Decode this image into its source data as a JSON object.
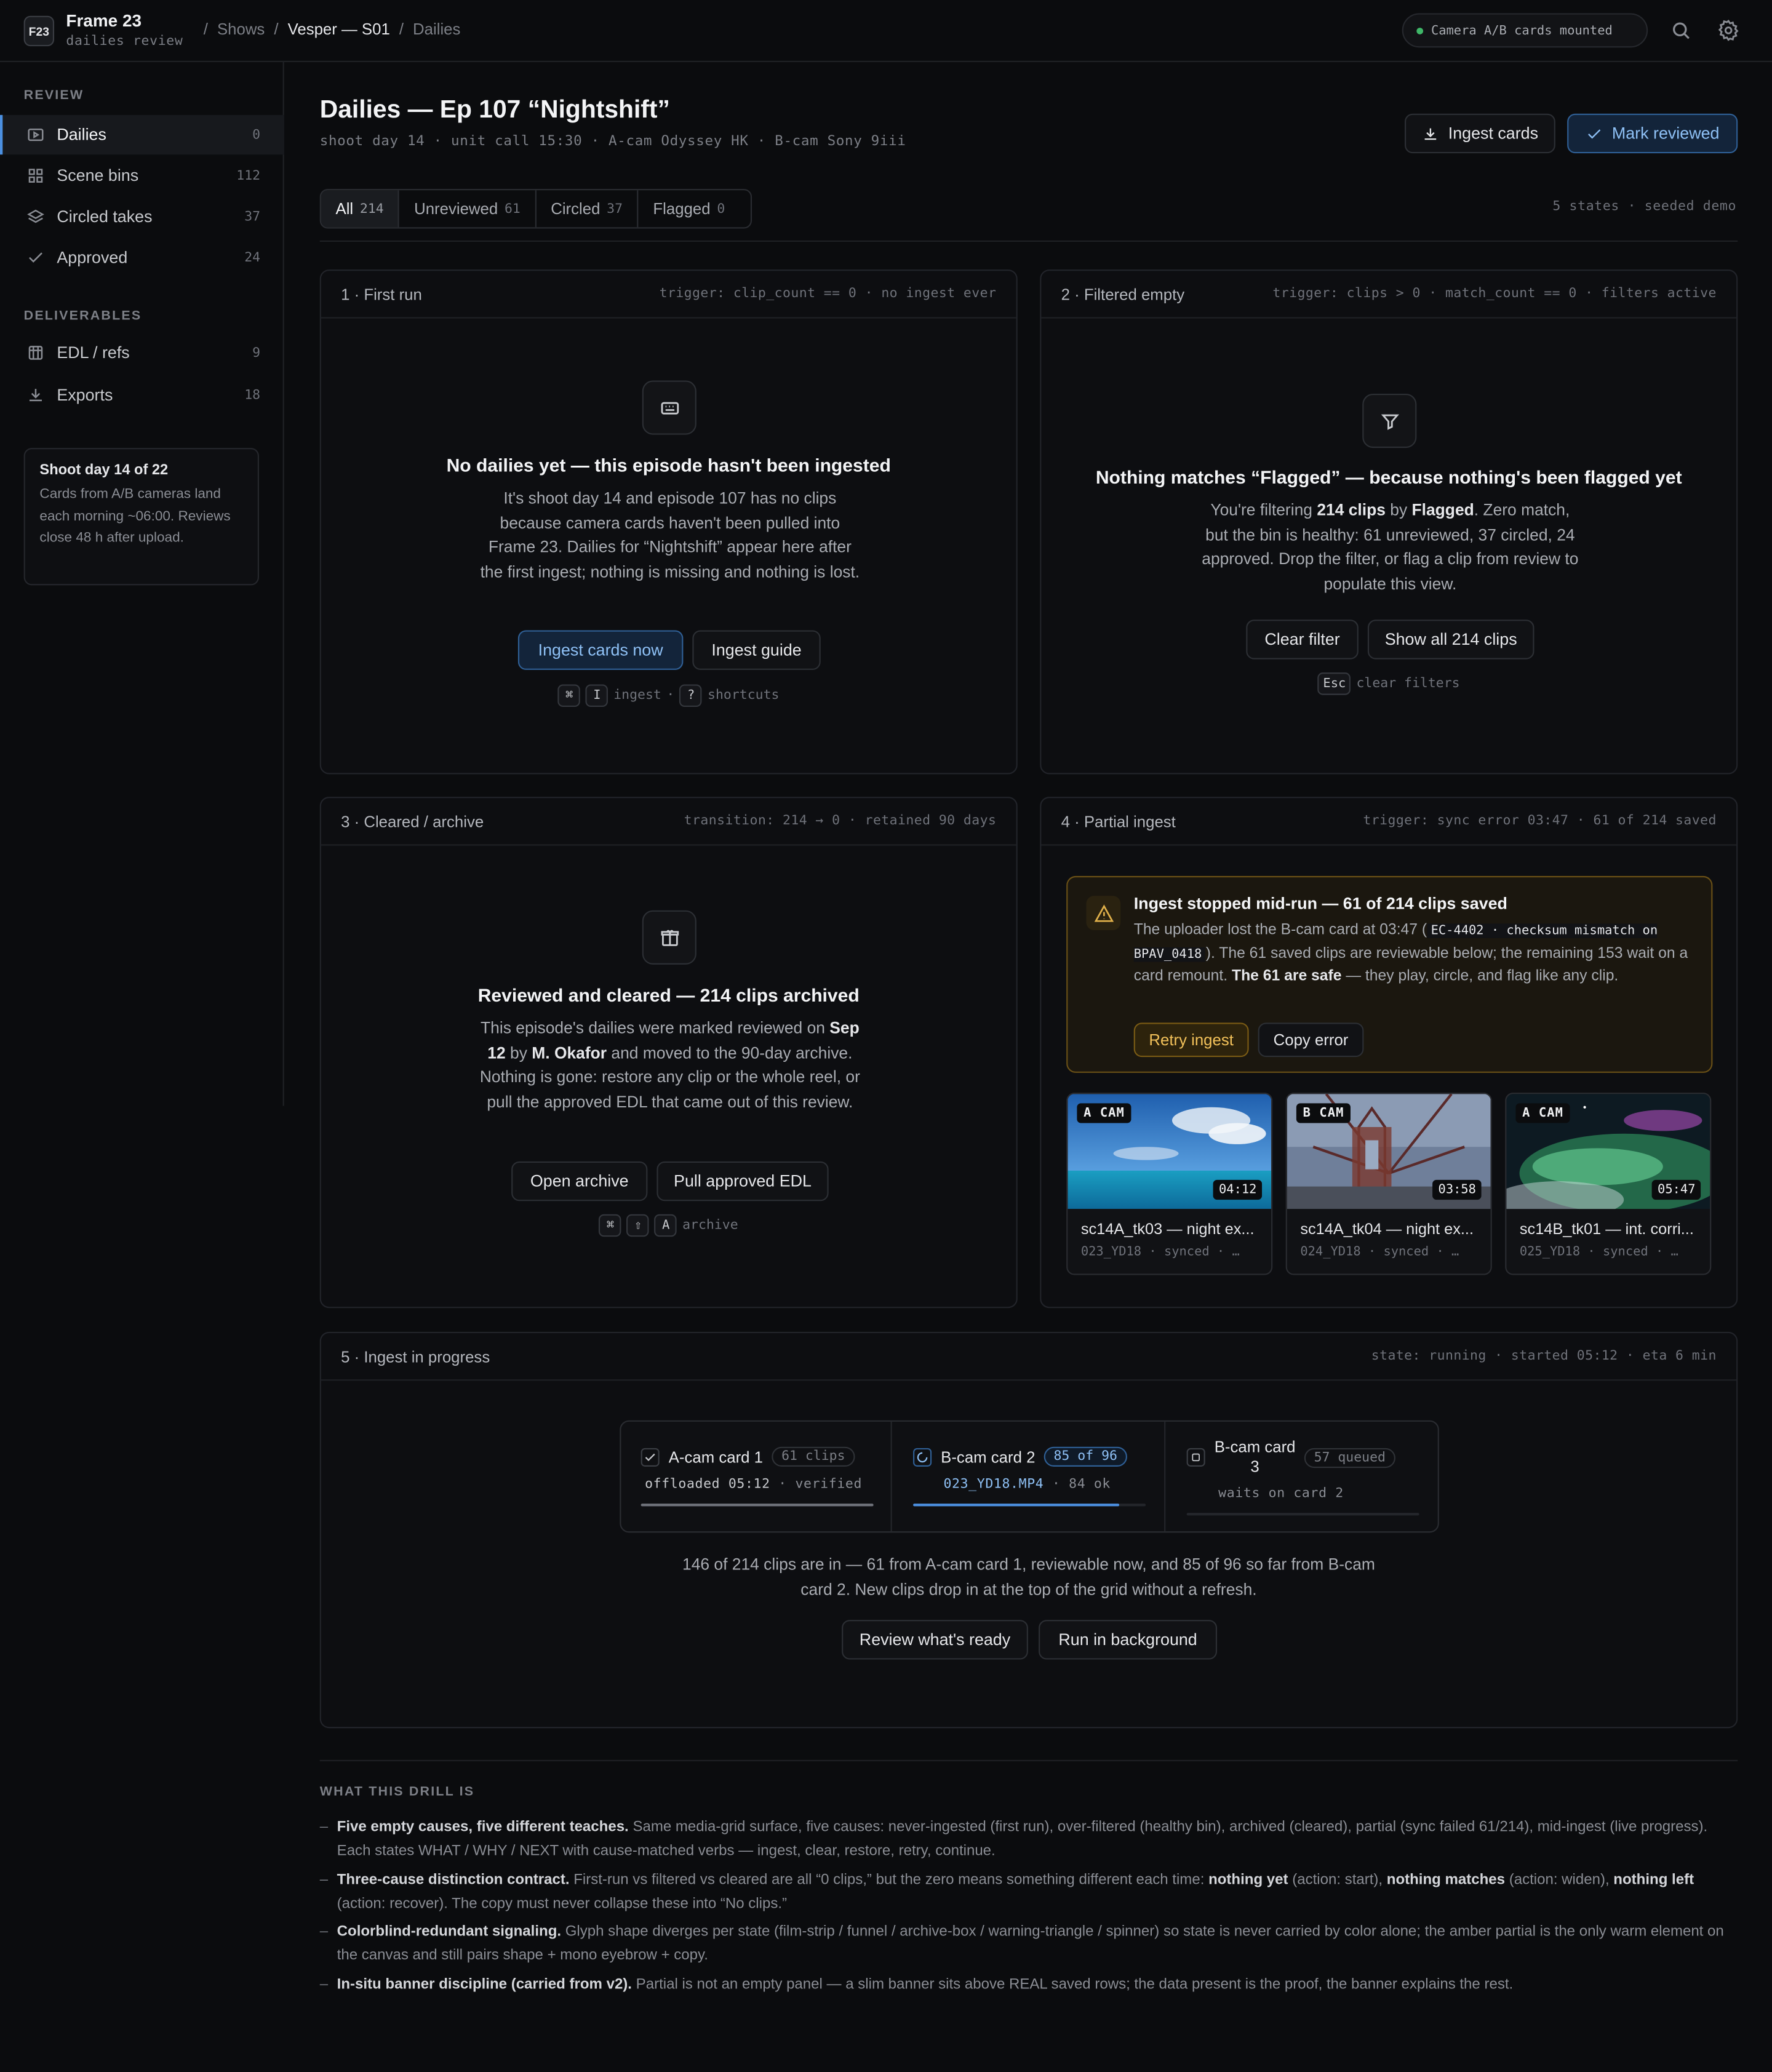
{
  "app": {
    "logo": "F23",
    "name": "Frame 23",
    "subtitle": "dailies review",
    "crumbs": [
      "Shows",
      "Vesper — S01",
      "Dailies"
    ],
    "status": "Camera A/B cards mounted"
  },
  "sidebar": {
    "review_heading": "REVIEW",
    "review": [
      {
        "label": "Dailies",
        "count": "0",
        "icon": "film-icon"
      },
      {
        "label": "Scene bins",
        "count": "112",
        "icon": "grid-icon"
      },
      {
        "label": "Circled takes",
        "count": "37",
        "icon": "layers-icon"
      },
      {
        "label": "Approved",
        "count": "24",
        "icon": "check-icon"
      }
    ],
    "deliverables_heading": "DELIVERABLES",
    "deliverables": [
      {
        "label": "EDL / refs",
        "count": "9",
        "icon": "archive-icon"
      },
      {
        "label": "Exports",
        "count": "18",
        "icon": "download-icon"
      }
    ],
    "card": {
      "title": "Shoot day 14 of 22",
      "body": "Cards from A/B cameras land each morning ~06:00. Reviews close 48 h after upload."
    }
  },
  "header": {
    "title": "Dailies — Ep 107 “Nightshift”",
    "meta": "shoot day 14 · unit call 15:30 · A-cam Odyssey HK · B-cam Sony 9iii",
    "ingest": "Ingest cards",
    "mark": "Mark reviewed"
  },
  "tabs": [
    {
      "label": "All",
      "n": "214"
    },
    {
      "label": "Unreviewed",
      "n": "61"
    },
    {
      "label": "Circled",
      "n": "37"
    },
    {
      "label": "Flagged",
      "n": "0"
    }
  ],
  "seeded": "5 states · seeded demo",
  "p1": {
    "title": "1 · First run",
    "meta": "trigger: clip_count == 0 · no ingest ever",
    "heading": "No dailies yet — this episode hasn't been ingested",
    "body": "It's shoot day 14 and episode 107 has no clips because camera cards haven't been pulled into Frame 23. Dailies for “Nightshift” appear here after the first ingest; nothing is missing and nothing is lost.",
    "primary": "Ingest cards now",
    "secondary": "Ingest guide",
    "k1": "⌘",
    "k2": "I",
    "k_label1": "ingest",
    "k_sep": "·",
    "k3": "?",
    "k_label2": "shortcuts"
  },
  "p2": {
    "title": "2 · Filtered empty",
    "meta": "trigger: clips > 0 · match_count == 0 · filters active",
    "heading": "Nothing matches “Flagged” — because nothing's been flagged yet",
    "b1": "You're filtering ",
    "b2": "214 clips",
    "b3": " by ",
    "b4": "Flagged",
    "b5": ". Zero match, but the bin is healthy: 61 unreviewed, 37 circled, 24 approved. Drop the filter, or flag a clip from review to populate this view.",
    "btn1": "Clear filter",
    "btn2": "Show all 214 clips",
    "k1": "Esc",
    "k_label": "clear filters"
  },
  "p3": {
    "title": "3 · Cleared / archive",
    "meta": "transition: 214 → 0 · retained 90 days",
    "heading": "Reviewed and cleared — 214 clips archived",
    "b1": "This episode's dailies were marked reviewed on ",
    "b2": "Sep 12",
    "b3": " by ",
    "b4": "M. Okafor",
    "b5": " and moved to the 90-day archive. Nothing is gone: restore any clip or the whole reel, or pull the approved EDL that came out of this review.",
    "btn1": "Open archive",
    "btn2": "Pull approved EDL",
    "k1": "⌘",
    "k2": "⇧",
    "k3": "A",
    "k_label": "archive"
  },
  "p4": {
    "title": "4 · Partial ingest",
    "meta": "trigger: sync error 03:47 · 61 of 214 saved",
    "banner_title": "Ingest stopped mid-run — 61 of 214 clips saved",
    "bb1": "The uploader lost the B-cam card at 03:47 (",
    "code": "EC-4402 · checksum mismatch on BPAV_0418",
    "bb2": "). The 61 saved clips are reviewable below; the remaining 153 wait on a card remount. ",
    "bb3": "The 61 are safe",
    "bb4": " — they play, circle, and flag like any clip.",
    "retry": "Retry ingest",
    "copy": "Copy error",
    "clips": [
      {
        "cam": "A CAM",
        "dur": "04:12",
        "name": "sc14A_tk03 — night ex...",
        "meta": "023_YD18 · synced · …"
      },
      {
        "cam": "B CAM",
        "dur": "03:58",
        "name": "sc14A_tk04 — night ex...",
        "meta": "024_YD18 · synced · …"
      },
      {
        "cam": "A CAM",
        "dur": "05:47",
        "name": "sc14B_tk01 — int. corri...",
        "meta": "025_YD18 · synced · …"
      }
    ]
  },
  "p5": {
    "title": "5 · Ingest in progress",
    "meta": "state: running · started 05:12 · eta 6 min",
    "c1": {
      "name": "A-cam card 1",
      "chip": "61 clips",
      "sub": "offloaded 05:12",
      "sub2": "· verified",
      "progress": 1.0
    },
    "c2": {
      "name": "B-cam card 2",
      "chip": "85 of 96",
      "sub": "023_YD18.MP4",
      "sub2": "· 84 ok",
      "progress": 0.885
    },
    "c3": {
      "name1": "B-cam card",
      "name2": "3",
      "chip": "57 queued",
      "sub": "waits on card 2",
      "progress": 0
    },
    "summary": "146 of 214 clips are in — 61 from A-cam card 1, reviewable now, and 85 of 96 so far from B-cam card 2. New clips drop in at the top of the grid without a refresh.",
    "btn1": "Review what's ready",
    "btn2": "Run in background"
  },
  "notes": {
    "heading": "WHAT THIS DRILL IS",
    "n1b": "Five empty causes, five different teaches.",
    "n1": " Same media-grid surface, five causes: never-ingested (first run), over-filtered (healthy bin), archived (cleared), partial (sync failed 61/214), mid-ingest (live progress). Each states WHAT / WHY / NEXT with cause-matched verbs — ingest, clear, restore, retry, continue.",
    "n2b": "Three-cause distinction contract.",
    "n2a": " First-run vs filtered vs cleared are all “0 clips,” but the zero means something different each time: ",
    "n2c": "nothing yet",
    "n2d": " (action: start), ",
    "n2e": "nothing matches",
    "n2f": " (action: widen), ",
    "n2g": "nothing left",
    "n2h": " (action: recover). The copy must never collapse these into “No clips.”",
    "n3b": "Colorblind-redundant signaling.",
    "n3": " Glyph shape diverges per state (film-strip / funnel / archive-box / warning-triangle / spinner) so state is never carried by color alone; the amber partial is the only warm element on the canvas and still pairs shape + mono eyebrow + copy.",
    "n4b": "In-situ banner discipline (carried from v2).",
    "n4": " Partial is not an empty panel — a slim banner sits above REAL saved rows; the data present is the proof, the banner explains the rest."
  }
}
